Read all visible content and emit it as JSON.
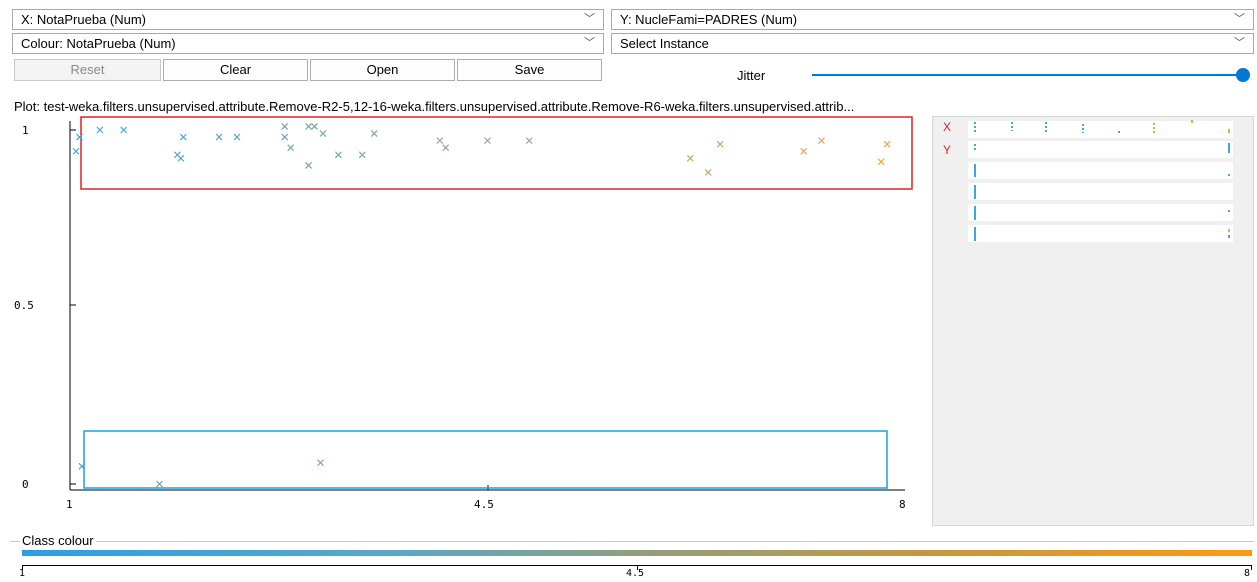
{
  "controls": {
    "x_select": "X: NotaPrueba (Num)",
    "y_select": "Y: NucleFami=PADRES (Num)",
    "colour_select": "Colour: NotaPrueba (Num)",
    "instance_select": "Select Instance",
    "chevron": "﹀"
  },
  "buttons": {
    "reset": "Reset",
    "clear": "Clear",
    "open": "Open",
    "save": "Save"
  },
  "jitter": {
    "label": "Jitter",
    "value": 1.0
  },
  "plot": {
    "title": "Plot: test-weka.filters.unsupervised.attribute.Remove-R2-5,12-16-weka.filters.unsupervised.attribute.Remove-R6-weka.filters.unsupervised.attrib...",
    "x_labels": [
      "1",
      "4.5",
      "8"
    ],
    "y_labels": [
      "0",
      "0.5",
      "1"
    ],
    "colors": {
      "low": "#3fa6e0",
      "high": "#f5a340",
      "selection_red": "#e02020",
      "selection_blue": "#1aa0e0"
    }
  },
  "side_panel": {
    "x_marker": "X",
    "y_marker": "Y"
  },
  "class_colour": {
    "label": "Class colour",
    "ticks": [
      "1",
      "4.5",
      "8"
    ]
  },
  "chart_data": {
    "type": "scatter",
    "xlim": [
      1,
      8
    ],
    "ylim": [
      0,
      1
    ],
    "x_ticks": [
      1,
      4.5,
      8
    ],
    "y_ticks": [
      0,
      0.5,
      1
    ],
    "marker": "x",
    "color_by": "x",
    "points": [
      {
        "x": 1.08,
        "y": 0.98
      },
      {
        "x": 1.25,
        "y": 1.0
      },
      {
        "x": 1.45,
        "y": 1.0
      },
      {
        "x": 1.05,
        "y": 0.94
      },
      {
        "x": 1.95,
        "y": 0.98
      },
      {
        "x": 1.9,
        "y": 0.93
      },
      {
        "x": 1.93,
        "y": 0.92
      },
      {
        "x": 2.25,
        "y": 0.98
      },
      {
        "x": 2.4,
        "y": 0.98
      },
      {
        "x": 2.8,
        "y": 1.01
      },
      {
        "x": 2.8,
        "y": 0.98
      },
      {
        "x": 2.85,
        "y": 0.95
      },
      {
        "x": 3.05,
        "y": 1.01
      },
      {
        "x": 3.0,
        "y": 1.01
      },
      {
        "x": 3.12,
        "y": 0.99
      },
      {
        "x": 3.0,
        "y": 0.9
      },
      {
        "x": 3.25,
        "y": 0.93
      },
      {
        "x": 3.45,
        "y": 0.93
      },
      {
        "x": 3.55,
        "y": 0.99
      },
      {
        "x": 4.1,
        "y": 0.97
      },
      {
        "x": 4.15,
        "y": 0.95
      },
      {
        "x": 4.5,
        "y": 0.97
      },
      {
        "x": 4.85,
        "y": 0.97
      },
      {
        "x": 6.2,
        "y": 0.92
      },
      {
        "x": 6.45,
        "y": 0.96
      },
      {
        "x": 6.35,
        "y": 0.88
      },
      {
        "x": 7.15,
        "y": 0.94
      },
      {
        "x": 7.3,
        "y": 0.97
      },
      {
        "x": 7.85,
        "y": 0.96
      },
      {
        "x": 7.8,
        "y": 0.91
      },
      {
        "x": 1.1,
        "y": 0.05
      },
      {
        "x": 3.1,
        "y": 0.06
      },
      {
        "x": 1.75,
        "y": 0.0
      }
    ]
  }
}
